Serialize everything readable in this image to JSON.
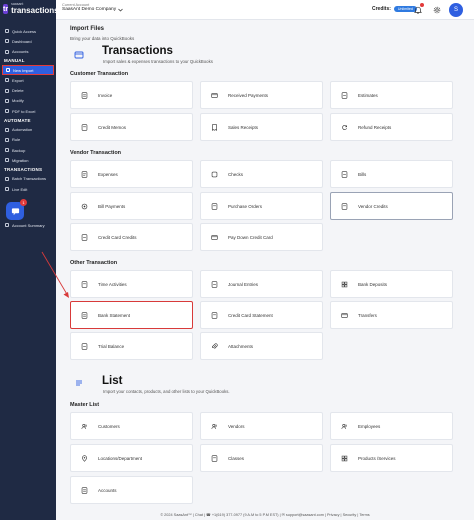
{
  "app": {
    "logo_small": "saasant",
    "logo_big": "transactions",
    "logo_mark": "tr"
  },
  "header": {
    "company_label": "Current Account",
    "company_name": "SaasAnt Demo Company",
    "credits_label": "Credits:",
    "credits_value": "Unlimited",
    "avatar_initial": "S"
  },
  "sidebar": {
    "items_top": [
      {
        "label": "Quick Access"
      },
      {
        "label": "Dashboard"
      },
      {
        "label": "Accounts"
      }
    ],
    "manual_title": "MANUAL",
    "manual_items": [
      {
        "label": "New Import"
      },
      {
        "label": "Export"
      },
      {
        "label": "Delete"
      },
      {
        "label": "Modify"
      },
      {
        "label": "PDF to Excel"
      }
    ],
    "automate_title": "AUTOMATE",
    "automate_items": [
      {
        "label": "Automation"
      },
      {
        "label": "Rule"
      },
      {
        "label": "Backup"
      },
      {
        "label": "Migration"
      }
    ],
    "transactions_title": "TRANSACTIONS",
    "transactions_items": [
      {
        "label": "Batch Transactions"
      },
      {
        "label": "Live Edit"
      }
    ],
    "bottom_items": [
      {
        "label": "Account Summary"
      }
    ],
    "chat_badge": "1"
  },
  "main": {
    "import_title": "Import Files",
    "import_sub": "Bring your data into QuickBooks",
    "transactions_title": "Transactions",
    "transactions_sub": "Import sales & expenses transactions to your QuickBooks",
    "customer_section": "Customer Transaction",
    "customer_cards": [
      "Invoice",
      "Received Payments",
      "Estimates",
      "Credit Memos",
      "Sales Receipts",
      "Refund Receipts"
    ],
    "vendor_section": "Vendor Transaction",
    "vendor_cards": [
      "Expenses",
      "Checks",
      "Bills",
      "Bill Payments",
      "Purchase Orders",
      "Vendor Credits",
      "Credit Card Credits",
      "Pay Down Credit Card"
    ],
    "other_section": "Other Transaction",
    "other_cards": [
      "Time Activities",
      "Journal Entries",
      "Bank Deposits",
      "Bank Statement",
      "Credit Card Statement",
      "Transfers",
      "Trial Balance",
      "Attachments"
    ],
    "list_title": "List",
    "list_sub": "Import your contacts, products, and other lists to your QuickBooks.",
    "master_section": "Master List",
    "master_cards": [
      "Customers",
      "Vendors",
      "Employees",
      "Locations/Department",
      "Classes",
      "Products /Services",
      "Accounts"
    ]
  },
  "footer": {
    "text": "© 2024 SaasAnt™ | Chat | ☎ +1(619) 377-0977 (9 A.M to 5 P.M EST) | ✉ support@saasant.com | Privacy | Security | Terms"
  }
}
